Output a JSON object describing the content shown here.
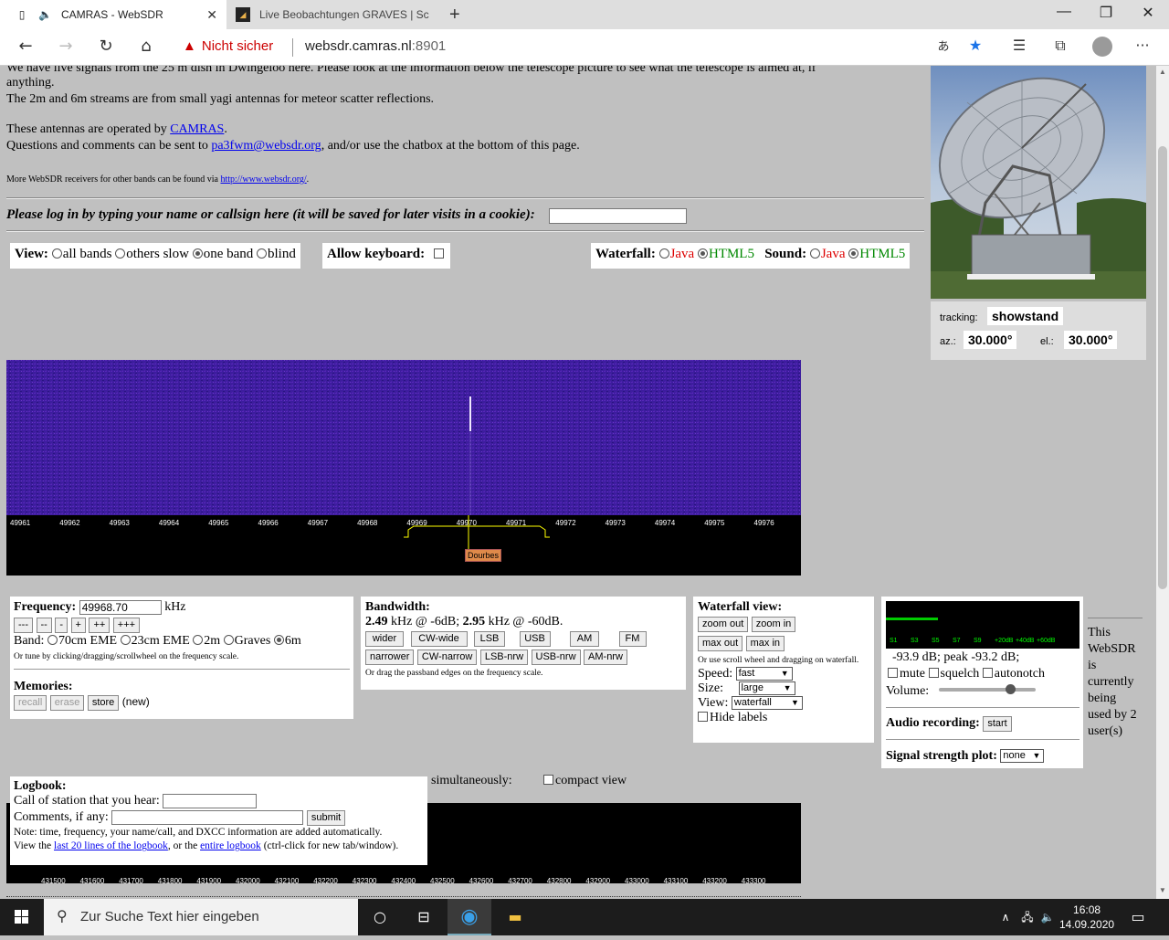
{
  "browser": {
    "tabs": [
      {
        "title": "CAMRAS - WebSDR"
      },
      {
        "title": "Live Beobachtungen GRAVES | Sc"
      }
    ],
    "security": "Nicht sicher",
    "url_host": "websdr.camras.nl",
    "url_port": ":8901"
  },
  "intro": {
    "line1": "We have live signals from the 25 m dish in Dwingeloo here. Please look at the information below the telescope picture to see what the telescope is aimed at, if",
    "line2": "anything.",
    "line3": "The 2m and 6m streams are from small yagi antennas for meteor scatter reflections.",
    "operated_prefix": "These antennas are operated by ",
    "operated_link": "CAMRAS",
    "operated_suffix": ".",
    "questions_prefix": "Questions and comments can be sent to ",
    "questions_email": "pa3fwm@websdr.org",
    "questions_suffix": ", and/or use the chatbox at the bottom of this page.",
    "more_prefix": "More WebSDR receivers for other bands can be found via ",
    "more_link": "http://www.websdr.org/",
    "more_suffix": "."
  },
  "login": {
    "label": "Please log in by typing your name or callsign here (it will be saved for later visits in a cookie):",
    "value": ""
  },
  "view": {
    "label": "View:",
    "options": [
      "all bands",
      "others slow",
      "one band",
      "blind"
    ],
    "selected": "one band",
    "keyboard_label": "Allow keyboard:",
    "waterfall_label": "Waterfall:",
    "sound_label": "Sound:",
    "java": "Java",
    "html5": "HTML5"
  },
  "telescope": {
    "tracking_label": "tracking:",
    "tracking": "showstand",
    "az_label": "az.:",
    "az": "30.000°",
    "el_label": "el.:",
    "el": "30.000°"
  },
  "scale": {
    "ticks": [
      "49961",
      "49962",
      "49963",
      "49964",
      "49965",
      "49966",
      "49967",
      "49968",
      "49969",
      "49970",
      "49971",
      "49972",
      "49973",
      "49974",
      "49975",
      "49976"
    ],
    "marker": "Dourbes"
  },
  "frequency": {
    "label": "Frequency:",
    "value": "49968.70",
    "unit": "kHz",
    "steps": [
      "---",
      "--",
      "-",
      "+",
      "++",
      "+++"
    ],
    "band_label": "Band:",
    "bands": [
      "70cm EME",
      "23cm EME",
      "2m",
      "Graves",
      "6m"
    ],
    "band_selected": "6m",
    "tune_hint": "Or tune by clicking/dragging/scrollwheel on the frequency scale.",
    "memories_label": "Memories:",
    "recall": "recall",
    "erase": "erase",
    "store": "store",
    "new": "(new)"
  },
  "bandwidth": {
    "label": "Bandwidth:",
    "bw6": "2.49",
    "bw6_text": " kHz @ -6dB; ",
    "bw60": "2.95",
    "bw60_text": " kHz @ -60dB.",
    "row1": [
      "wider",
      "CW-wide",
      "LSB",
      "USB",
      "AM",
      "FM"
    ],
    "row2": [
      "narrower",
      "CW-narrow",
      "LSB-nrw",
      "USB-nrw",
      "AM-nrw"
    ],
    "hint": "Or drag the passband edges on the frequency scale."
  },
  "waterfall_view": {
    "label": "Waterfall view:",
    "zoom_out": "zoom out",
    "zoom_in": "zoom in",
    "max_out": "max out",
    "max_in": "max in",
    "hint": "Or use scroll wheel and dragging on waterfall.",
    "speed_label": "Speed:",
    "speed": "fast",
    "size_label": "Size:",
    "size": "large",
    "view_label": "View:",
    "view": "waterfall",
    "hide_labels": "Hide labels"
  },
  "audio": {
    "smeter_labels": [
      "S1",
      "S3",
      "S5",
      "S7",
      "S9",
      "+20dB",
      "+40dB",
      "+60dB"
    ],
    "signal_level": 0.27,
    "level_text": "-93.9 dB; peak   -93.2 dB;",
    "mute": "mute",
    "squelch": "squelch",
    "autonotch": "autonotch",
    "volume_label": "Volume:",
    "volume_level": 0.74,
    "recording_label": "Audio recording:",
    "start": "start",
    "plot_label": "Signal strength plot:",
    "plot": "none"
  },
  "usage": {
    "line1": "This",
    "line2": "WebSDR",
    "line3": "is",
    "line4": "currently",
    "line5": "being",
    "line6": "used by 2",
    "line7": "user(s)"
  },
  "logbook": {
    "label": "Logbook:",
    "call_label": "Call of station that you hear:",
    "comments_label": "Comments, if any:",
    "submit": "submit",
    "note": "Note: time, frequency, your name/call, and DXCC information are added automatically.",
    "view_prefix": "View the ",
    "last_link": "last 20 lines of the logbook",
    "or": ", or the ",
    "entire_link": "entire logbook",
    "view_suffix": " (ctrl-click for new tab/window)."
  },
  "compact": {
    "simultaneously": "simultaneously:",
    "compact_view": "compact view"
  },
  "lower_scale": {
    "ticks": [
      "431500",
      "431600",
      "431700",
      "431800",
      "431900",
      "432000",
      "432100",
      "432200",
      "432300",
      "432400",
      "432500",
      "432600",
      "432700",
      "432800",
      "432900",
      "433000",
      "433100",
      "433200",
      "433300"
    ]
  },
  "taskbar": {
    "search": "Zur Suche Text hier eingeben",
    "time": "16:08",
    "date": "14.09.2020"
  }
}
